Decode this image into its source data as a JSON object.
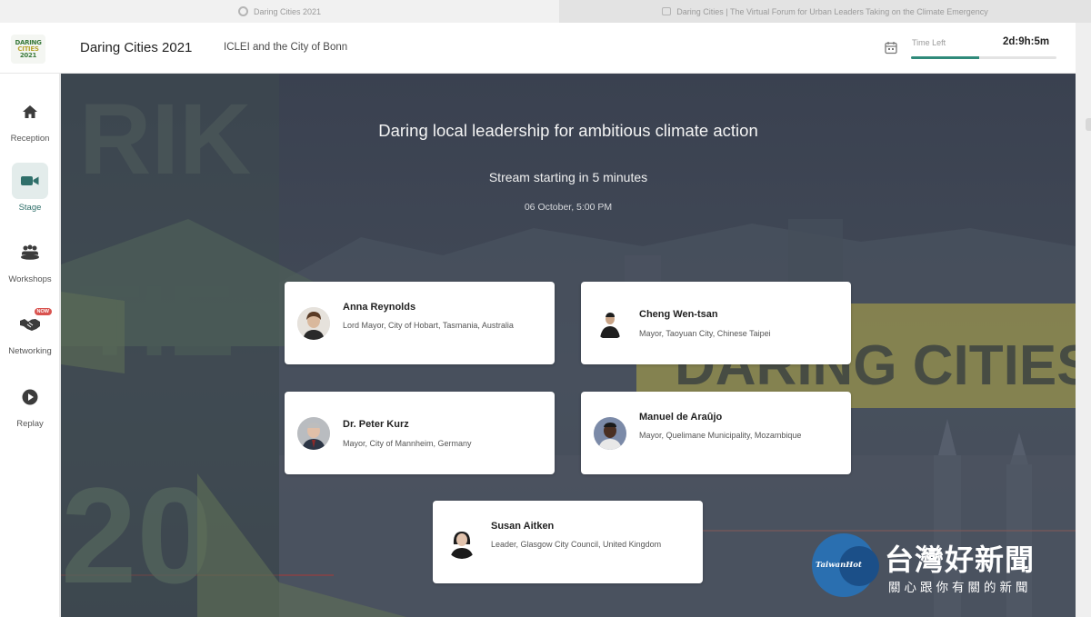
{
  "browser": {
    "tabs": [
      {
        "title": "Daring Cities 2021",
        "active": false
      },
      {
        "title": "Daring Cities | The Virtual Forum for Urban Leaders Taking on the Climate Emergency",
        "active": true
      }
    ]
  },
  "header": {
    "logo": {
      "line1": "DARING",
      "line2": "CITIES",
      "line3": "2021"
    },
    "event_title": "Daring Cities 2021",
    "organizer": "ICLEI and the City of Bonn",
    "time_left_label": "Time Left",
    "time_left_value": "2d:9h:5m",
    "time_left_progress": 0.47,
    "icons": {
      "calendar": "calendar-icon"
    }
  },
  "sidebar": {
    "items": [
      {
        "label": "Reception",
        "icon": "home-icon",
        "active": false,
        "badge": ""
      },
      {
        "label": "Stage",
        "icon": "video-camera-icon",
        "active": true,
        "badge": ""
      },
      {
        "label": "Workshops",
        "icon": "group-table-icon",
        "active": false,
        "badge": ""
      },
      {
        "label": "Networking",
        "icon": "handshake-icon",
        "active": false,
        "badge": "NOW"
      },
      {
        "label": "Replay",
        "icon": "play-circle-icon",
        "active": false,
        "badge": ""
      }
    ]
  },
  "stage": {
    "title": "Daring local leadership for ambitious climate action",
    "status": "Stream starting in 5 minutes",
    "date": "06 October, 5:00 PM",
    "background_text": "DARING CITIES",
    "accent_color": "#2f8a7a",
    "speakers": [
      {
        "name": "Anna Reynolds",
        "role": "Lord Mayor, City of Hobart, Tasmania, Australia"
      },
      {
        "name": "Cheng Wen-tsan",
        "role": "Mayor, Taoyuan City, Chinese Taipei"
      },
      {
        "name": "Dr. Peter Kurz",
        "role": "Mayor, City of Mannheim, Germany"
      },
      {
        "name": "Manuel de Araûjo",
        "role": "Mayor, Quelimane Municipality, Mozambique"
      },
      {
        "name": "Susan Aitken",
        "role": "Leader, Glasgow City Council, United Kingdom"
      }
    ]
  },
  "watermark": {
    "brand": "TaiwanHot",
    "title_cn": "台灣好新聞",
    "subtitle_cn": "關心跟你有關的新聞"
  }
}
